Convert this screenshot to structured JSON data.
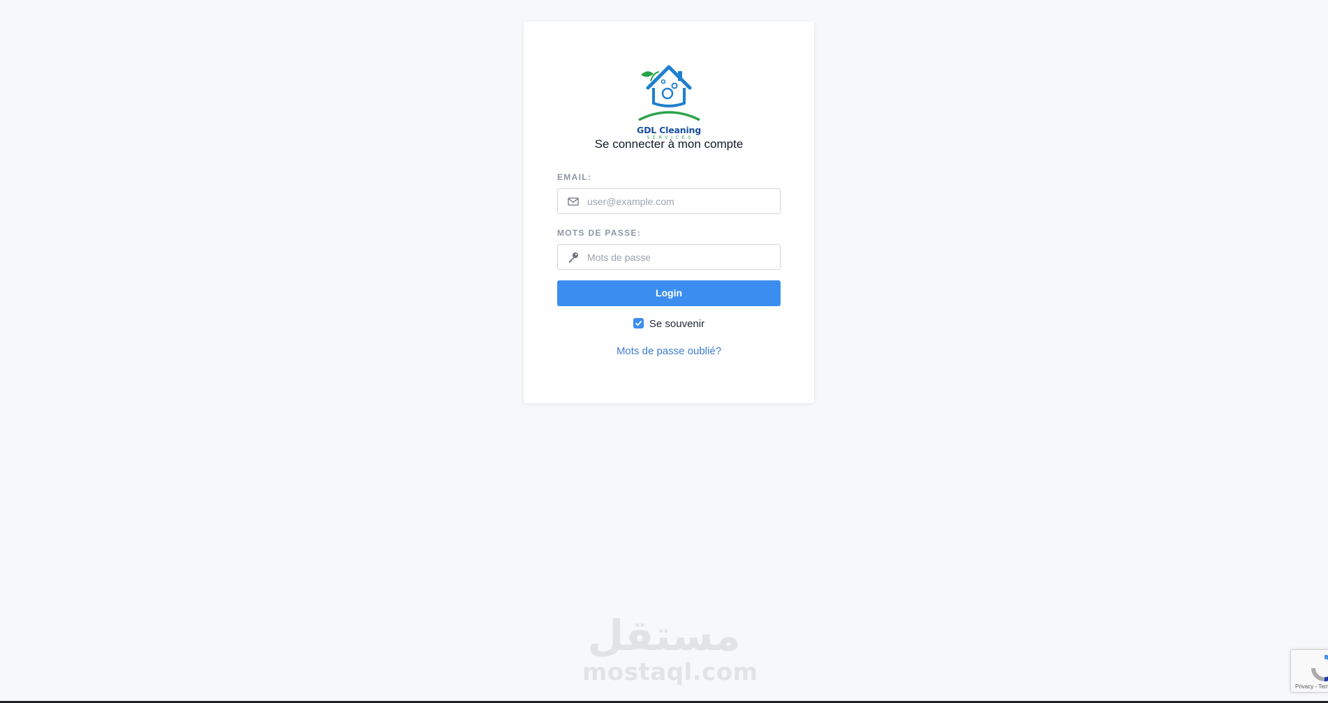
{
  "brand": {
    "logo_name": "GDL Cleaning",
    "logo_tagline": "SERVICES"
  },
  "login": {
    "title": "Se connecter à mon compte",
    "email_label": "EMAIL:",
    "email_placeholder": "user@example.com",
    "email_value": "",
    "password_label": "MOTS DE PASSE:",
    "password_placeholder": "Mots de passe",
    "password_value": "",
    "login_button": "Login",
    "remember_label": "Se souvenir",
    "remember_checked": true,
    "forgot_link": "Mots de passe oublié?"
  },
  "watermark": {
    "arabic": "مستقل",
    "latin": "mostaql.com"
  },
  "recaptcha": {
    "text": "Privacy - Terms"
  },
  "colors": {
    "background": "#f7f8fa",
    "accent": "#3b8ef0",
    "link": "#3d7ccf",
    "label": "#8d97a7"
  },
  "icons": {
    "email": "envelope-icon",
    "password": "key-icon",
    "checkbox": "check-icon"
  }
}
